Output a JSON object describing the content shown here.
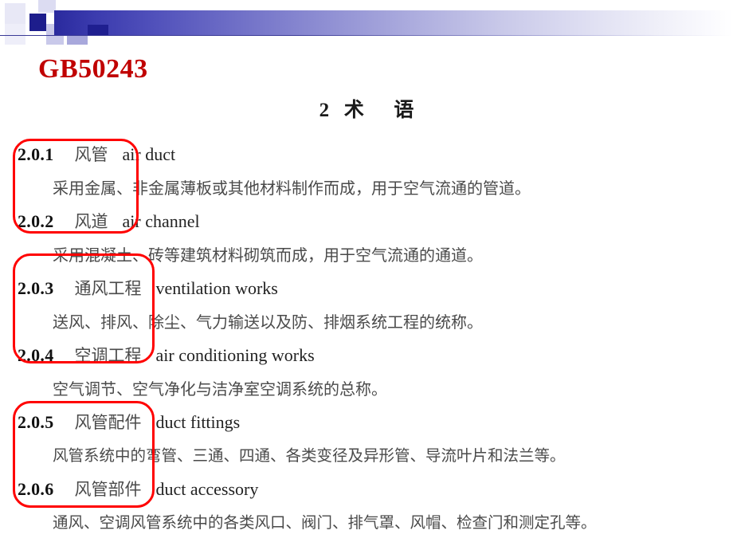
{
  "slide": {
    "doc_title": "GB50243",
    "section_heading": "2   术      语",
    "colors": {
      "title_red": "#c00000",
      "annotation_red": "#ff0000",
      "band_dark_blue": "#2a2a9e",
      "band_navy_square": "#1d1d8c"
    }
  },
  "header": {
    "band_name": "gradient-band",
    "squares_name": "checker-squares"
  },
  "terms": [
    {
      "number": "2.0.1",
      "chinese": "风管",
      "english": "air duct",
      "definition": "采用金属、非金属薄板或其他材料制作而成，用于空气流通的管道。"
    },
    {
      "number": "2.0.2",
      "chinese": "风道",
      "english": "air channel",
      "definition": "采用混凝土、砖等建筑材料砌筑而成，用于空气流通的通道。"
    },
    {
      "number": "2.0.3",
      "chinese": "通风工程",
      "english": "ventilation works",
      "definition": "送风、排风、除尘、气力输送以及防、排烟系统工程的统称。"
    },
    {
      "number": "2.0.4",
      "chinese": "空调工程",
      "english": "air conditioning works",
      "definition": "空气调节、空气净化与洁净室空调系统的总称。"
    },
    {
      "number": "2.0.5",
      "chinese": "风管配件",
      "english": "duct fittings",
      "definition": "风管系统中的弯管、三通、四通、各类变径及异形管、导流叶片和法兰等。"
    },
    {
      "number": "2.0.6",
      "chinese": "风管部件",
      "english": "duct accessory",
      "definition": "通风、空调风管系统中的各类风口、阀门、排气罩、风帽、检查门和测定孔等。"
    }
  ],
  "annotations": [
    {
      "label": "highlight-box-1",
      "covers": "2.0.1 - 2.0.2"
    },
    {
      "label": "highlight-box-2",
      "covers": "2.0.3 - 2.0.4"
    },
    {
      "label": "highlight-box-3",
      "covers": "2.0.5 - 2.0.6"
    }
  ]
}
